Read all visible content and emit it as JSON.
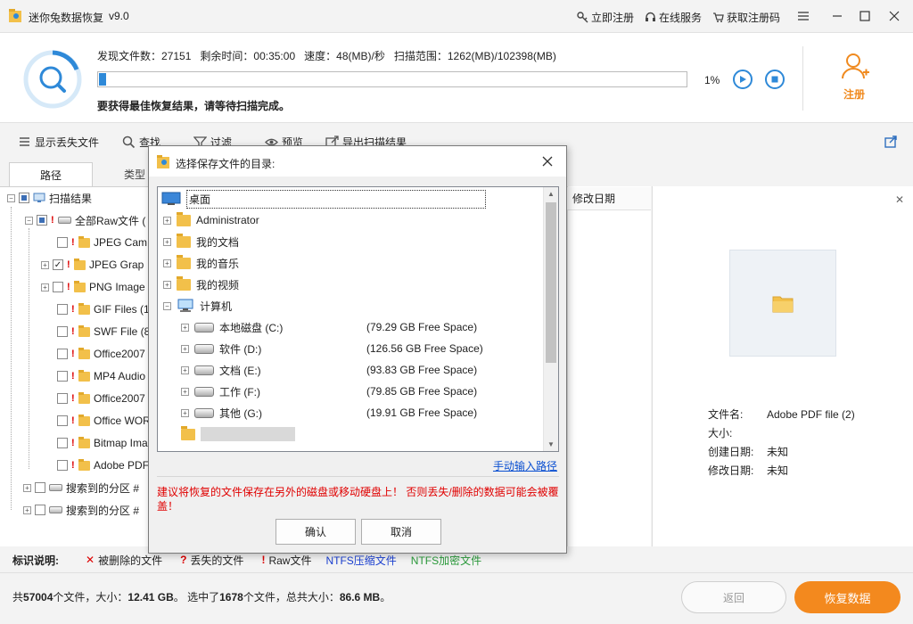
{
  "titlebar": {
    "app_name": "迷你兔数据恢复",
    "version": "v9.0",
    "register_link": "立即注册",
    "support_link": "在线服务",
    "get_code_link": "获取注册码"
  },
  "scan": {
    "found_label": "发现文件数：",
    "found_value": "27151",
    "remaining_label": "剩余时间：",
    "remaining_value": "00:35:00",
    "speed_label": "速度：",
    "speed_value": "48(MB)/秒",
    "range_label": "扫描范围：",
    "range_value": "1262(MB)/102398(MB)",
    "percent": "1%",
    "progress_fraction": 0.012,
    "hint": "要获得最佳恢复结果，请等待扫描完成。",
    "register_label": "注册"
  },
  "toolbar": {
    "show_lost": "显示丢失文件",
    "find": "查找",
    "filter": "过滤",
    "preview": "预览",
    "export": "导出扫描结果"
  },
  "tabs": {
    "path": "路径",
    "type": "类型"
  },
  "tree": {
    "root": "扫描结果",
    "raw": "全部Raw文件 (",
    "items": [
      "JPEG Cam",
      "JPEG Grap",
      "PNG Image",
      "GIF Files (1",
      "SWF File (8",
      "Office2007",
      "MP4 Audio",
      "Office2007",
      "Office WOR",
      "Bitmap Ima",
      "Adobe PDF"
    ],
    "partition1": "搜索到的分区 #",
    "partition2": "搜索到的分区 #"
  },
  "list": {
    "col_modified": "修改日期"
  },
  "preview": {
    "name_label": "文件名:",
    "name_value": "Adobe PDF file (2)",
    "size_label": "大小:",
    "size_value": "",
    "created_label": "创建日期:",
    "created_value": "未知",
    "modified_label": "修改日期:",
    "modified_value": "未知"
  },
  "legend": {
    "title": "标识说明:",
    "deleted": "被删除的文件",
    "lost": "丢失的文件",
    "raw": "Raw文件",
    "ntfs_compressed": "NTFS压缩文件",
    "ntfs_encrypted": "NTFS加密文件"
  },
  "footer": {
    "summary_prefix": "共",
    "total_files": "57004",
    "summary_mid": "个文件，大小：",
    "total_size": "12.41 GB",
    "summary_mid2": "。 选中了",
    "selected_files": "1678",
    "summary_mid3": "个文件，总共大小：",
    "selected_size": "86.6 MB",
    "summary_end": "。",
    "back_button": "返回",
    "recover_button": "恢复数据"
  },
  "dialog": {
    "title": "选择保存文件的目录:",
    "desktop": "桌面",
    "administrator": "Administrator",
    "documents": "我的文档",
    "music": "我的音乐",
    "videos": "我的视频",
    "computer": "计算机",
    "drives": [
      {
        "name": "本地磁盘 (C:)",
        "free": "(79.29 GB Free Space)"
      },
      {
        "name": "软件 (D:)",
        "free": "(126.56 GB Free Space)"
      },
      {
        "name": "文档 (E:)",
        "free": "(93.83 GB Free Space)"
      },
      {
        "name": "工作 (F:)",
        "free": "(79.85 GB Free Space)"
      },
      {
        "name": "其他 (G:)",
        "free": "(19.91 GB Free Space)"
      }
    ],
    "manual_path": "手动输入路径",
    "warning": "建议将恢复的文件保存在另外的磁盘或移动硬盘上！ 否则丢失/删除的数据可能会被覆盖！",
    "ok": "确认",
    "cancel": "取消"
  },
  "colors": {
    "accent_blue": "#2e89d8",
    "accent_orange": "#f3891e",
    "warning_red": "#e00000"
  }
}
